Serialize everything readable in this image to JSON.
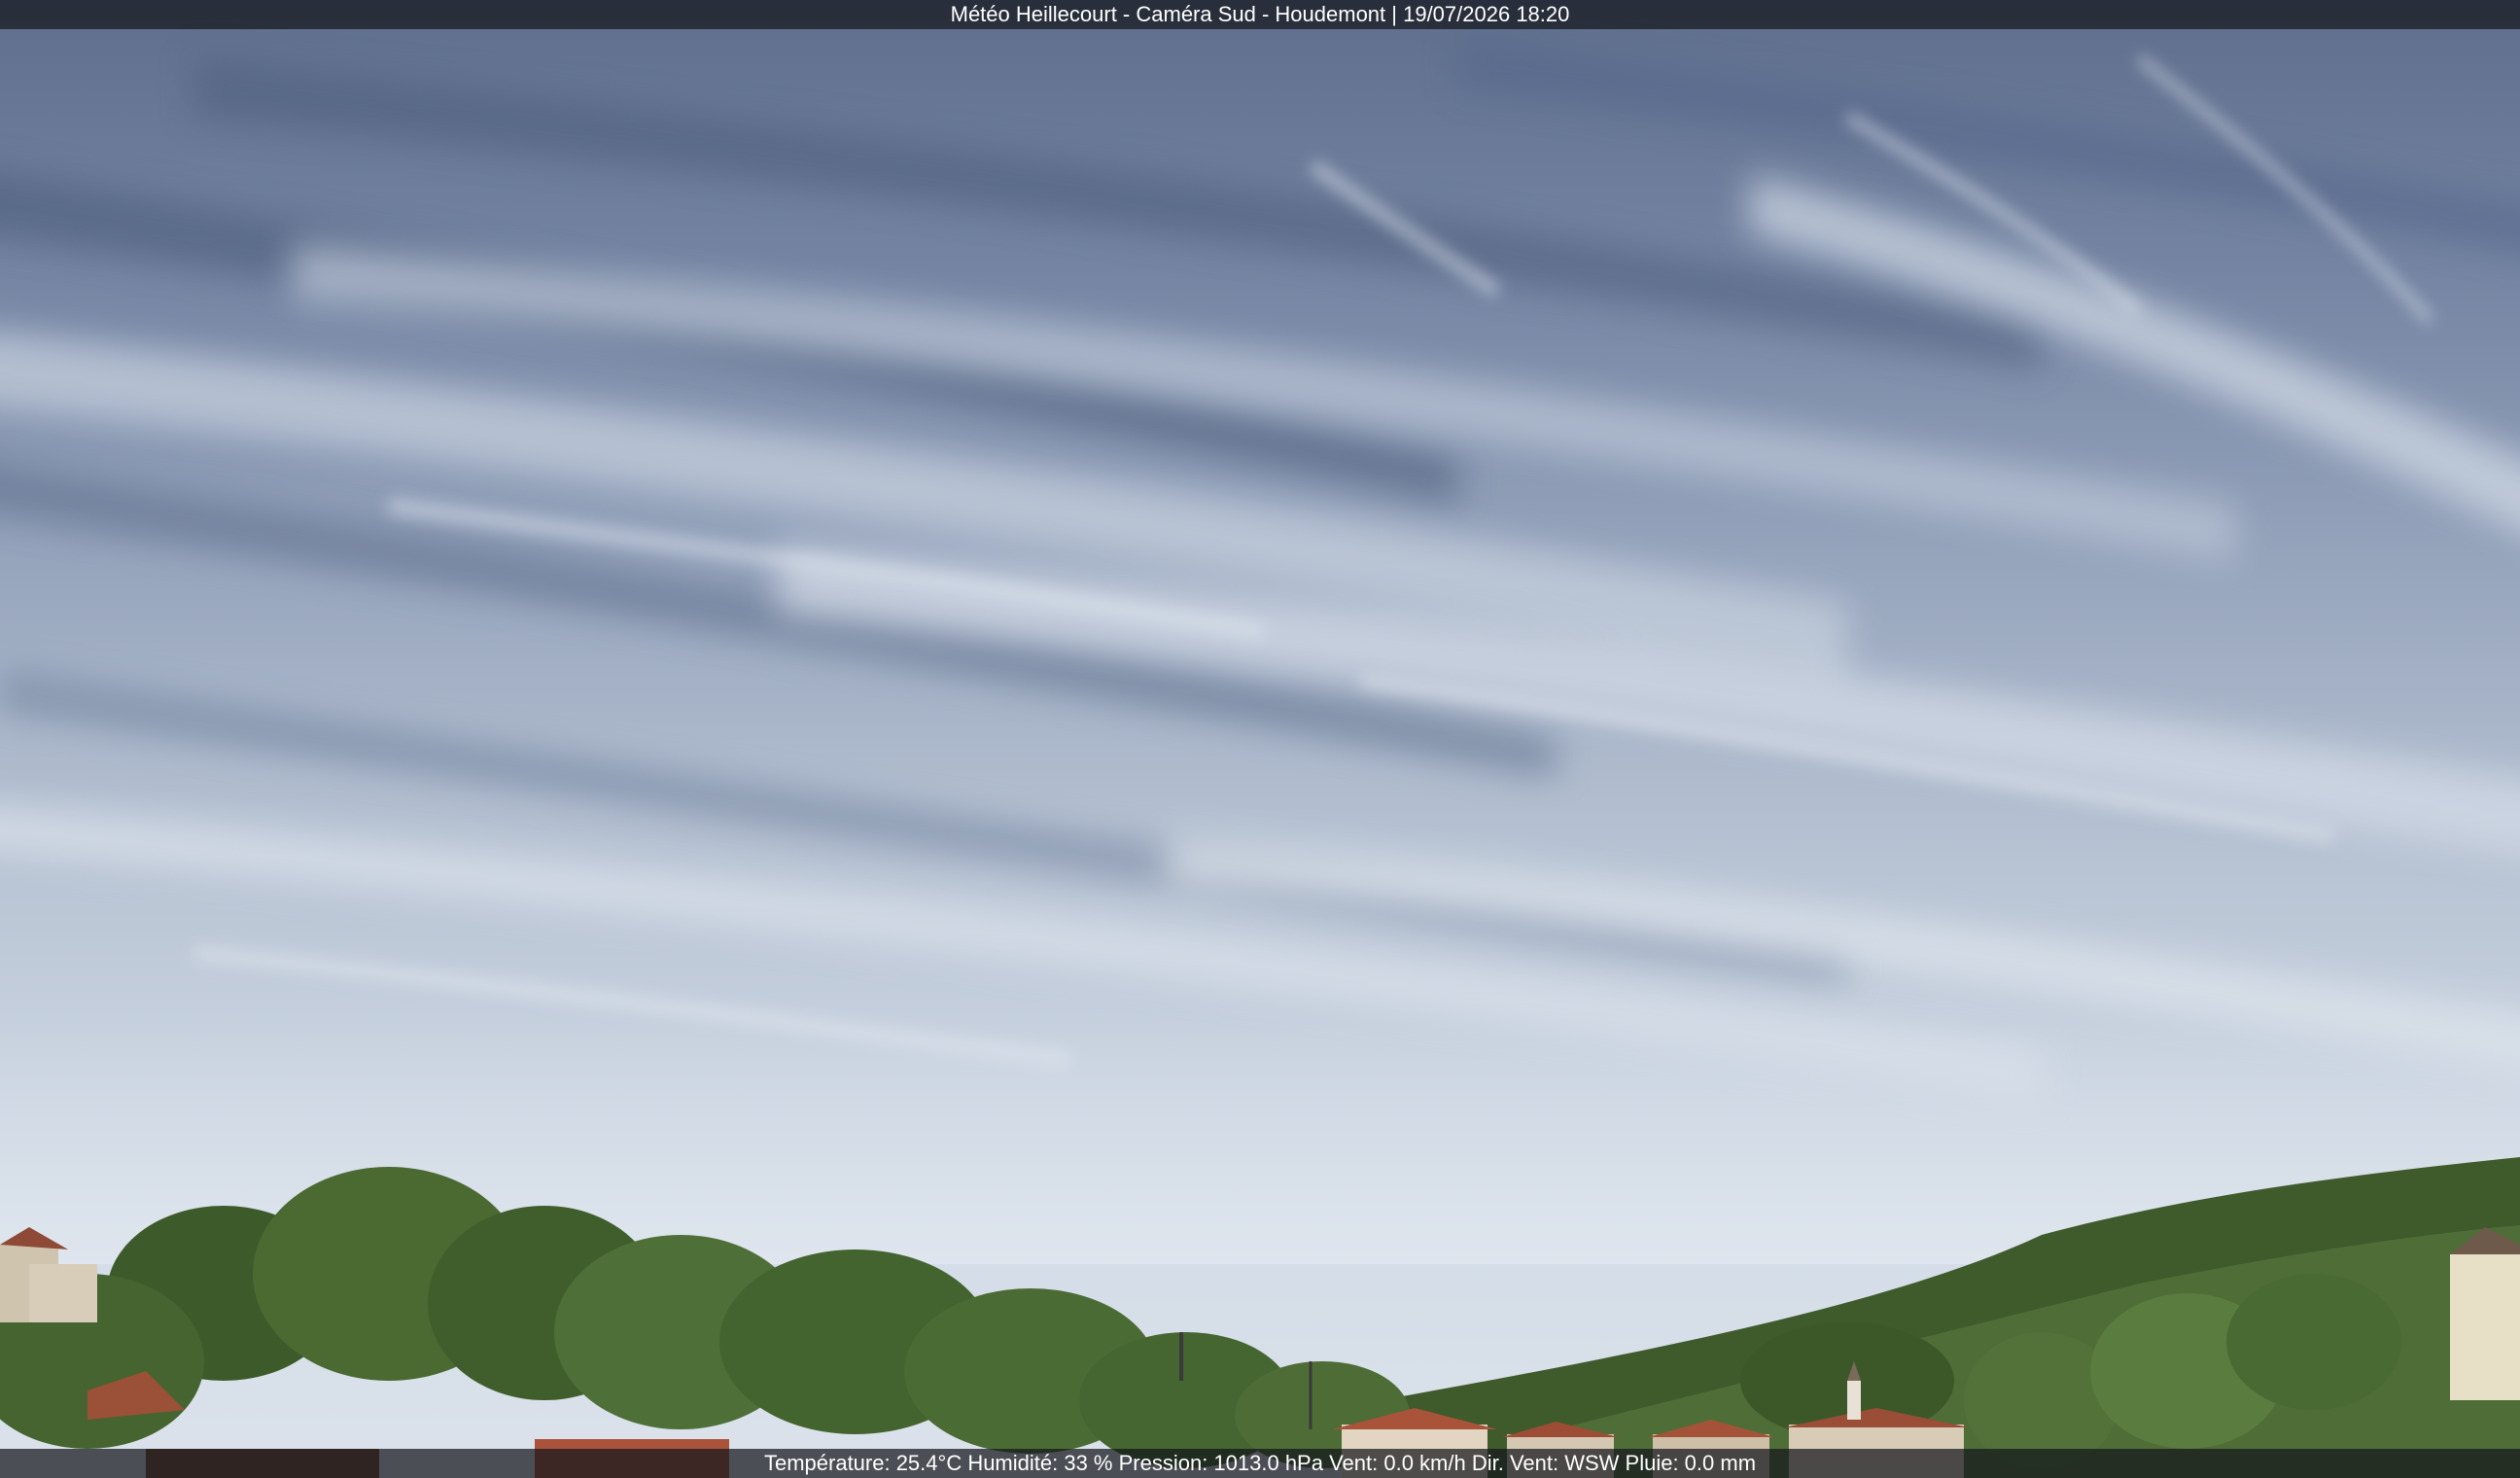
{
  "header": {
    "caption": "Météo Heillecourt - Caméra Sud - Houdemont | 19/07/2026 18:20"
  },
  "footer": {
    "caption": "Température: 25.4°C  Humidité: 33 % Pression: 1013.0 hPa Vent: 0.0 km/h Dir. Vent: WSW Pluie: 0.0 mm"
  },
  "colors": {
    "sky_top": "#5e6e8c",
    "sky_horizon": "#dbe2ea",
    "foliage": "#4c6a34",
    "roof": "#a8533a",
    "overlay": "#14161c"
  }
}
